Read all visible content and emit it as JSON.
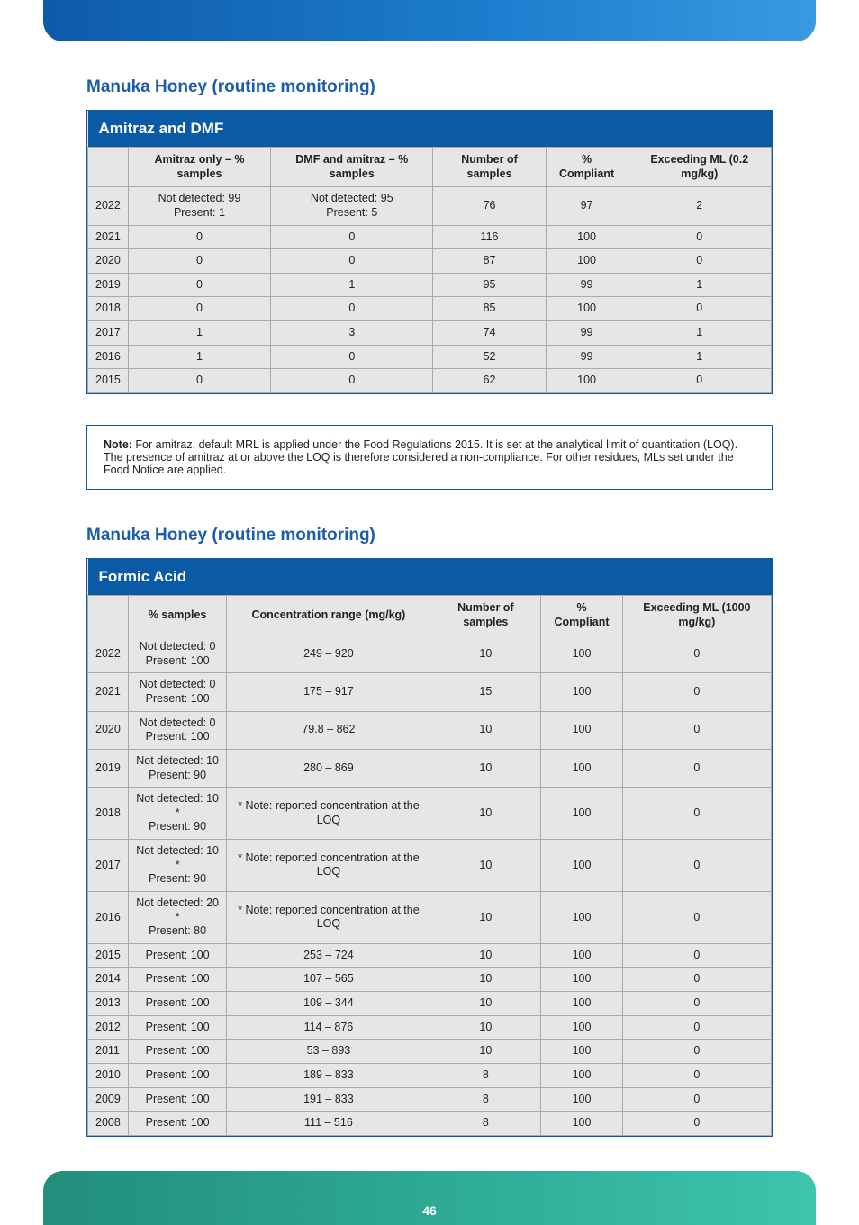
{
  "page_number": "46",
  "section1_title": "Manuka Honey (routine monitoring)",
  "table1": {
    "title": "Amitraz and DMF",
    "headers": [
      "",
      "Amitraz only – % samples",
      "DMF and amitraz – % samples",
      "Number of samples",
      "% Compliant",
      "Exceeding ML\n(0.2 mg/kg)"
    ],
    "rows": [
      {
        "label": "2022",
        "c1": "Not detected: 99\nPresent: 1",
        "c2": "Not detected: 95\nPresent: 5",
        "n": "76",
        "compliant": "97",
        "exceed": "2"
      },
      {
        "label": "2021",
        "c1": "0",
        "c2": "0",
        "n": "116",
        "compliant": "100",
        "exceed": "0"
      },
      {
        "label": "2020",
        "c1": "0",
        "c2": "0",
        "n": "87",
        "compliant": "100",
        "exceed": "0"
      },
      {
        "label": "2019",
        "c1": "0",
        "c2": "1",
        "n": "95",
        "compliant": "99",
        "exceed": "1"
      },
      {
        "label": "2018",
        "c1": "0",
        "c2": "0",
        "n": "85",
        "compliant": "100",
        "exceed": "0"
      },
      {
        "label": "2017",
        "c1": "1",
        "c2": "3",
        "n": "74",
        "compliant": "99",
        "exceed": "1"
      },
      {
        "label": "2016",
        "c1": "1",
        "c2": "0",
        "n": "52",
        "compliant": "99",
        "exceed": "1"
      },
      {
        "label": "2015",
        "c1": "0",
        "c2": "0",
        "n": "62",
        "compliant": "100",
        "exceed": "0"
      }
    ]
  },
  "note": {
    "label": "Note:",
    "text": " For amitraz, default MRL is applied under the Food Regulations 2015. It is set at the analytical limit of quantitation (LOQ). The presence of amitraz at or above the LOQ is therefore considered a non-compliance. For other residues, MLs set under the Food Notice are applied."
  },
  "section2_title": "Manuka Honey (routine monitoring)",
  "table2": {
    "title": "Formic Acid",
    "headers": [
      "",
      "% samples",
      "Concentration range (mg/kg)",
      "Number of samples",
      "% Compliant",
      "Exceeding ML\n(1000 mg/kg)"
    ],
    "rows": [
      {
        "label": "2022",
        "c": "Not detected: 0\nPresent: 100",
        "range": "249 – 920",
        "n": "10",
        "compliant": "100",
        "exceed": "0"
      },
      {
        "label": "2021",
        "c": "Not detected: 0\nPresent: 100",
        "range": "175 – 917",
        "n": "15",
        "compliant": "100",
        "exceed": "0"
      },
      {
        "label": "2020",
        "c": "Not detected: 0\nPresent: 100",
        "range": "79.8 – 862",
        "n": "10",
        "compliant": "100",
        "exceed": "0"
      },
      {
        "label": "2019",
        "c": "Not detected: 10\nPresent: 90",
        "range": "280 – 869",
        "n": "10",
        "compliant": "100",
        "exceed": "0"
      },
      {
        "label": "2018",
        "c": "Not detected: 10 *\nPresent: 90",
        "range": "* Note: reported concentration at the LOQ",
        "n": "10",
        "compliant": "100",
        "exceed": "0"
      },
      {
        "label": "2017",
        "c": "Not detected: 10 *\nPresent: 90",
        "range": "* Note: reported concentration at the LOQ",
        "n": "10",
        "compliant": "100",
        "exceed": "0"
      },
      {
        "label": "2016",
        "c": "Not detected: 20 *\nPresent: 80",
        "range": "* Note: reported concentration at the LOQ",
        "n": "10",
        "compliant": "100",
        "exceed": "0"
      },
      {
        "label": "2015",
        "c": "Present: 100",
        "range": "253 – 724",
        "n": "10",
        "compliant": "100",
        "exceed": "0"
      },
      {
        "label": "2014",
        "c": "Present: 100",
        "range": "107 – 565",
        "n": "10",
        "compliant": "100",
        "exceed": "0"
      },
      {
        "label": "2013",
        "c": "Present: 100",
        "range": "109 – 344",
        "n": "10",
        "compliant": "100",
        "exceed": "0"
      },
      {
        "label": "2012",
        "c": "Present: 100",
        "range": "114 – 876",
        "n": "10",
        "compliant": "100",
        "exceed": "0"
      },
      {
        "label": "2011",
        "c": "Present: 100",
        "range": "53 – 893",
        "n": "10",
        "compliant": "100",
        "exceed": "0"
      },
      {
        "label": "2010",
        "c": "Present: 100",
        "range": "189 – 833",
        "n": "8",
        "compliant": "100",
        "exceed": "0"
      },
      {
        "label": "2009",
        "c": "Present: 100",
        "range": "191 – 833",
        "n": "8",
        "compliant": "100",
        "exceed": "0"
      },
      {
        "label": "2008",
        "c": "Present: 100",
        "range": "111 – 516",
        "n": "8",
        "compliant": "100",
        "exceed": "0"
      }
    ]
  },
  "chart_data": [
    {
      "type": "table",
      "title": "Amitraz and DMF — Manuka Honey (routine monitoring)",
      "columns": [
        "Year",
        "Amitraz only – % samples",
        "DMF and amitraz – % samples",
        "Number of samples",
        "% Compliant",
        "Exceeding ML (0.2 mg/kg)"
      ],
      "rows": [
        [
          "2022",
          "Not detected: 99 / Present: 1",
          "Not detected: 95 / Present: 5",
          76,
          97,
          2
        ],
        [
          "2021",
          0,
          0,
          116,
          100,
          0
        ],
        [
          "2020",
          0,
          0,
          87,
          100,
          0
        ],
        [
          "2019",
          0,
          1,
          95,
          99,
          1
        ],
        [
          "2018",
          0,
          0,
          85,
          100,
          0
        ],
        [
          "2017",
          1,
          3,
          74,
          99,
          1
        ],
        [
          "2016",
          1,
          0,
          52,
          99,
          1
        ],
        [
          "2015",
          0,
          0,
          62,
          100,
          0
        ]
      ]
    },
    {
      "type": "table",
      "title": "Formic Acid — Manuka Honey (routine monitoring)",
      "columns": [
        "Year",
        "% samples",
        "Concentration range (mg/kg)",
        "Number of samples",
        "% Compliant",
        "Exceeding ML (1000 mg/kg)"
      ],
      "rows": [
        [
          "2022",
          "Not detected: 0 / Present: 100",
          "249 – 920",
          10,
          100,
          0
        ],
        [
          "2021",
          "Not detected: 0 / Present: 100",
          "175 – 917",
          15,
          100,
          0
        ],
        [
          "2020",
          "Not detected: 0 / Present: 100",
          "79.8 – 862",
          10,
          100,
          0
        ],
        [
          "2019",
          "Not detected: 10 / Present: 90",
          "280 – 869",
          10,
          100,
          0
        ],
        [
          "2018",
          "Not detected: 10 * / Present: 90",
          "* reported concentration at the LOQ",
          10,
          100,
          0
        ],
        [
          "2017",
          "Not detected: 10 * / Present: 90",
          "* reported concentration at the LOQ",
          10,
          100,
          0
        ],
        [
          "2016",
          "Not detected: 20 * / Present: 80",
          "* reported concentration at the LOQ",
          10,
          100,
          0
        ],
        [
          "2015",
          "Present: 100",
          "253 – 724",
          10,
          100,
          0
        ],
        [
          "2014",
          "Present: 100",
          "107 – 565",
          10,
          100,
          0
        ],
        [
          "2013",
          "Present: 100",
          "109 – 344",
          10,
          100,
          0
        ],
        [
          "2012",
          "Present: 100",
          "114 – 876",
          10,
          100,
          0
        ],
        [
          "2011",
          "Present: 100",
          "53 – 893",
          10,
          100,
          0
        ],
        [
          "2010",
          "Present: 100",
          "189 – 833",
          8,
          100,
          0
        ],
        [
          "2009",
          "Present: 100",
          "191 – 833",
          8,
          100,
          0
        ],
        [
          "2008",
          "Present: 100",
          "111 – 516",
          8,
          100,
          0
        ]
      ]
    }
  ]
}
